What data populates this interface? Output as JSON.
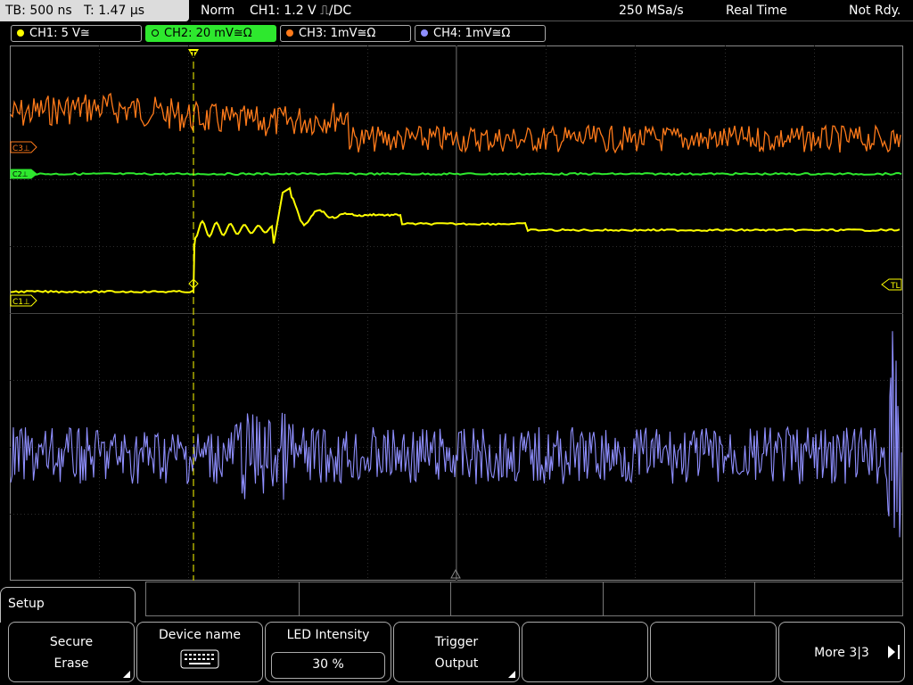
{
  "status": {
    "timebase": "TB: 500 ns",
    "trigger_time": "T: 1.47 µs",
    "mode": "Norm",
    "trigger_info": "CH1: 1.2 V ⎍/DC",
    "sample_rate": "250 MSa/s",
    "acq_mode": "Real Time",
    "state": "Not Rdy."
  },
  "channels": [
    {
      "label": "CH1: 5 V≅",
      "color": "#ffff00"
    },
    {
      "label": "CH2: 20 mV≅Ω",
      "color": "#2ee82e",
      "active": true
    },
    {
      "label": "CH3: 1mV≅Ω",
      "color": "#ff7a1a"
    },
    {
      "label": "CH4: 1mV≅Ω",
      "color": "#8f8fff"
    }
  ],
  "markers": {
    "c3": "C3⊥",
    "c2": "C2⊥",
    "c1": "C1⊥",
    "tl": "TL",
    "trigger": "T"
  },
  "menu": {
    "title": "Setup",
    "buttons": [
      {
        "line1": "Secure",
        "line2": "Erase"
      },
      {
        "line1": "Device name",
        "icon": "keyboard-icon"
      },
      {
        "line1": "LED Intensity",
        "value": "30 %"
      },
      {
        "line1": "Trigger",
        "line2": "Output"
      },
      {
        "line1": ""
      },
      {
        "line1": ""
      },
      {
        "line1": "More 3|3"
      }
    ]
  }
}
